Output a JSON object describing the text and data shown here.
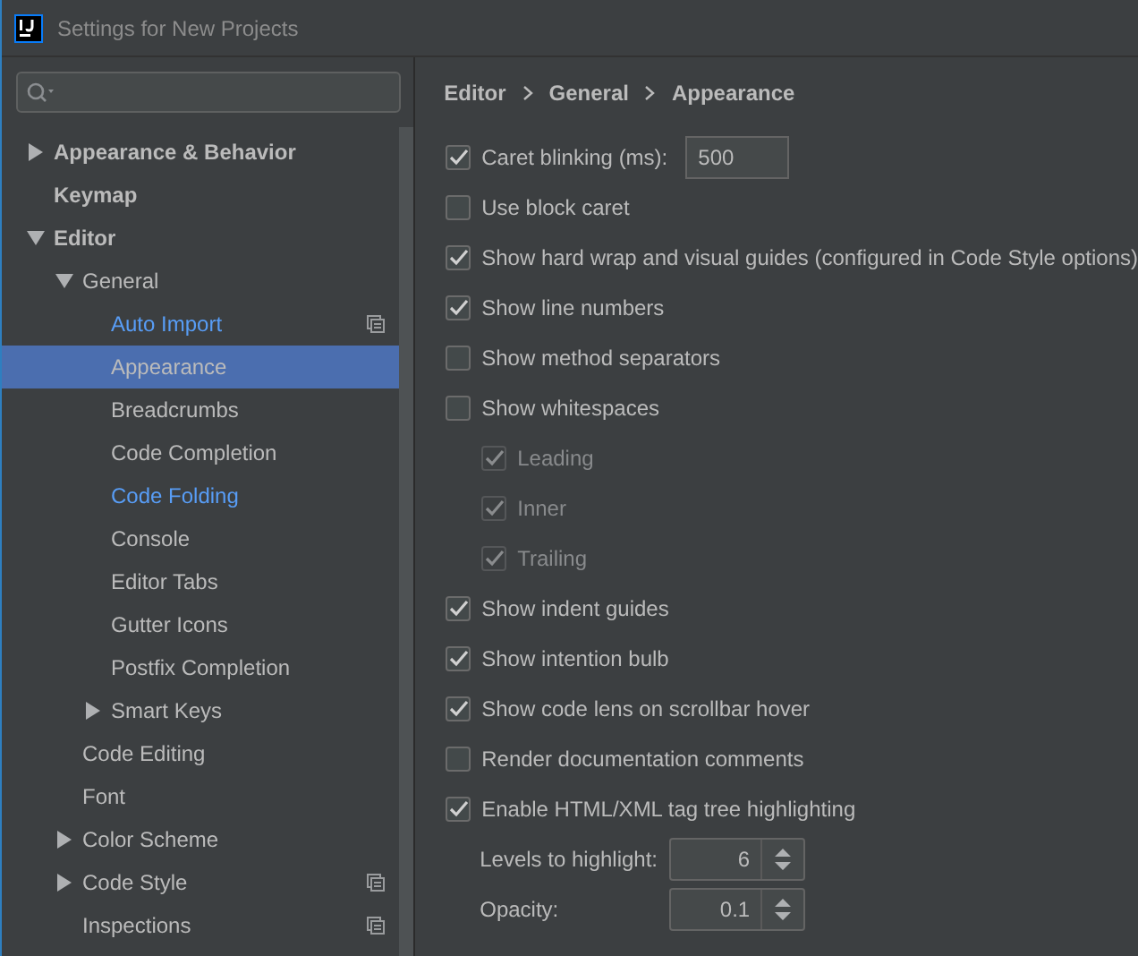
{
  "window": {
    "title": "Settings for New Projects"
  },
  "tree": [
    {
      "label": "Appearance & Behavior",
      "expanded": false,
      "selected": false,
      "modified": false,
      "scope_icon": false
    },
    {
      "label": "Keymap",
      "selected": false,
      "modified": false,
      "scope_icon": false
    },
    {
      "label": "Editor",
      "expanded": true,
      "selected": false,
      "modified": false,
      "scope_icon": false,
      "children": [
        {
          "label": "General",
          "expanded": true,
          "selected": false,
          "modified": false,
          "scope_icon": false,
          "children": [
            {
              "label": "Auto Import",
              "selected": false,
              "modified": true,
              "scope_icon": true
            },
            {
              "label": "Appearance",
              "selected": true,
              "modified": false,
              "scope_icon": false
            },
            {
              "label": "Breadcrumbs",
              "selected": false,
              "modified": false,
              "scope_icon": false
            },
            {
              "label": "Code Completion",
              "selected": false,
              "modified": false,
              "scope_icon": false
            },
            {
              "label": "Code Folding",
              "selected": false,
              "modified": true,
              "scope_icon": false
            },
            {
              "label": "Console",
              "selected": false,
              "modified": false,
              "scope_icon": false
            },
            {
              "label": "Editor Tabs",
              "selected": false,
              "modified": false,
              "scope_icon": false
            },
            {
              "label": "Gutter Icons",
              "selected": false,
              "modified": false,
              "scope_icon": false
            },
            {
              "label": "Postfix Completion",
              "selected": false,
              "modified": false,
              "scope_icon": false
            },
            {
              "label": "Smart Keys",
              "expanded": false,
              "selected": false,
              "modified": false,
              "scope_icon": false
            }
          ]
        },
        {
          "label": "Code Editing",
          "selected": false,
          "modified": false,
          "scope_icon": false
        },
        {
          "label": "Font",
          "selected": false,
          "modified": false,
          "scope_icon": false
        },
        {
          "label": "Color Scheme",
          "expanded": false,
          "selected": false,
          "modified": false,
          "scope_icon": false
        },
        {
          "label": "Code Style",
          "expanded": false,
          "selected": false,
          "modified": false,
          "scope_icon": true
        },
        {
          "label": "Inspections",
          "selected": false,
          "modified": false,
          "scope_icon": true
        }
      ]
    }
  ],
  "breadcrumb": [
    "Editor",
    "General",
    "Appearance"
  ],
  "options": [
    {
      "kind": "checkbox",
      "label": "Caret blinking (ms):",
      "checked": true,
      "disabled": false,
      "value": "500"
    },
    {
      "kind": "checkbox",
      "label": "Use block caret",
      "checked": false,
      "disabled": false
    },
    {
      "kind": "checkbox",
      "label": "Show hard wrap and visual guides (configured in Code Style options)",
      "checked": true,
      "disabled": false
    },
    {
      "kind": "checkbox",
      "label": "Show line numbers",
      "checked": true,
      "disabled": false
    },
    {
      "kind": "checkbox",
      "label": "Show method separators",
      "checked": false,
      "disabled": false
    },
    {
      "kind": "checkbox",
      "label": "Show whitespaces",
      "checked": false,
      "disabled": false,
      "children": [
        {
          "kind": "checkbox",
          "label": "Leading",
          "checked": true,
          "disabled": true
        },
        {
          "kind": "checkbox",
          "label": "Inner",
          "checked": true,
          "disabled": true
        },
        {
          "kind": "checkbox",
          "label": "Trailing",
          "checked": true,
          "disabled": true
        }
      ]
    },
    {
      "kind": "checkbox",
      "label": "Show indent guides",
      "checked": true,
      "disabled": false
    },
    {
      "kind": "checkbox",
      "label": "Show intention bulb",
      "checked": true,
      "disabled": false
    },
    {
      "kind": "checkbox",
      "label": "Show code lens on scrollbar hover",
      "checked": true,
      "disabled": false
    },
    {
      "kind": "checkbox",
      "label": "Render documentation comments",
      "checked": false,
      "disabled": false
    },
    {
      "kind": "checkbox",
      "label": "Enable HTML/XML tag tree highlighting",
      "checked": true,
      "disabled": false
    },
    {
      "kind": "spinner",
      "label": "Levels to highlight:",
      "value": "6"
    },
    {
      "kind": "spinner",
      "label": "Opacity:",
      "value": "0.1"
    }
  ]
}
